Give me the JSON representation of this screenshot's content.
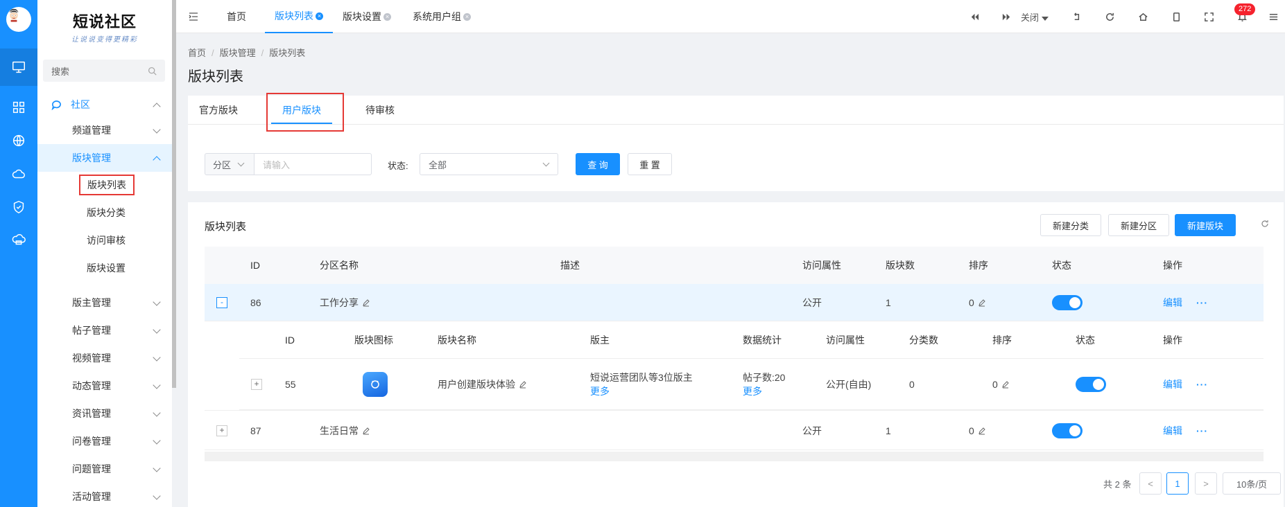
{
  "brand": {
    "title": "短说社区",
    "subtitle": "让说说变得更精彩"
  },
  "sidebar": {
    "search_placeholder": "搜索",
    "section": "社区",
    "menus": [
      {
        "label": "频道管理"
      },
      {
        "label": "版块管理"
      },
      {
        "label": "版主管理"
      },
      {
        "label": "帖子管理"
      },
      {
        "label": "视频管理"
      },
      {
        "label": "动态管理"
      },
      {
        "label": "资讯管理"
      },
      {
        "label": "问卷管理"
      },
      {
        "label": "问题管理"
      },
      {
        "label": "活动管理"
      }
    ],
    "submenus": [
      {
        "label": "版块列表"
      },
      {
        "label": "版块分类"
      },
      {
        "label": "访问审核"
      },
      {
        "label": "版块设置"
      }
    ]
  },
  "topbar": {
    "tabs": [
      {
        "label": "首页"
      },
      {
        "label": "版块列表"
      },
      {
        "label": "版块设置"
      },
      {
        "label": "系统用户组"
      }
    ],
    "close_label": "关闭",
    "notification_count": "272"
  },
  "breadcrumb": [
    "首页",
    "版块管理",
    "版块列表"
  ],
  "page_title": "版块列表",
  "content_tabs": [
    "官方版块",
    "用户版块",
    "待审核"
  ],
  "filter": {
    "region_label": "分区",
    "region_placeholder": "请输入",
    "status_label": "状态:",
    "status_value": "全部",
    "query_button": "查 询",
    "reset_button": "重 置"
  },
  "list": {
    "title": "版块列表",
    "buttons": {
      "new_category": "新建分类",
      "new_zone": "新建分区",
      "new_board": "新建版块"
    },
    "columns": [
      "ID",
      "分区名称",
      "描述",
      "访问属性",
      "版块数",
      "排序",
      "状态",
      "操作"
    ],
    "rows": [
      {
        "id": "86",
        "name": "工作分享",
        "desc": "",
        "access": "公开",
        "count": "1",
        "order": "0",
        "action": "编辑",
        "more": "···"
      },
      {
        "id": "87",
        "name": "生活日常",
        "desc": "",
        "access": "公开",
        "count": "1",
        "order": "0",
        "action": "编辑",
        "more": "···"
      }
    ],
    "nested_columns": [
      "ID",
      "版块图标",
      "版块名称",
      "版主",
      "数据统计",
      "访问属性",
      "分类数",
      "排序",
      "状态",
      "操作"
    ],
    "nested_row": {
      "id": "55",
      "name": "用户创建版块体验",
      "moderator": "短说运营团队等3位版主",
      "moderator_more": "更多",
      "stats": "帖子数:20",
      "stats_more": "更多",
      "access": "公开(自由)",
      "category_count": "0",
      "order": "0",
      "action": "编辑",
      "more": "···"
    },
    "expander_open": "-",
    "expander_closed": "+"
  },
  "pagination": {
    "total": "共 2 条",
    "current_page": "1",
    "page_size": "10条/页",
    "prev": "<",
    "next": ">"
  }
}
